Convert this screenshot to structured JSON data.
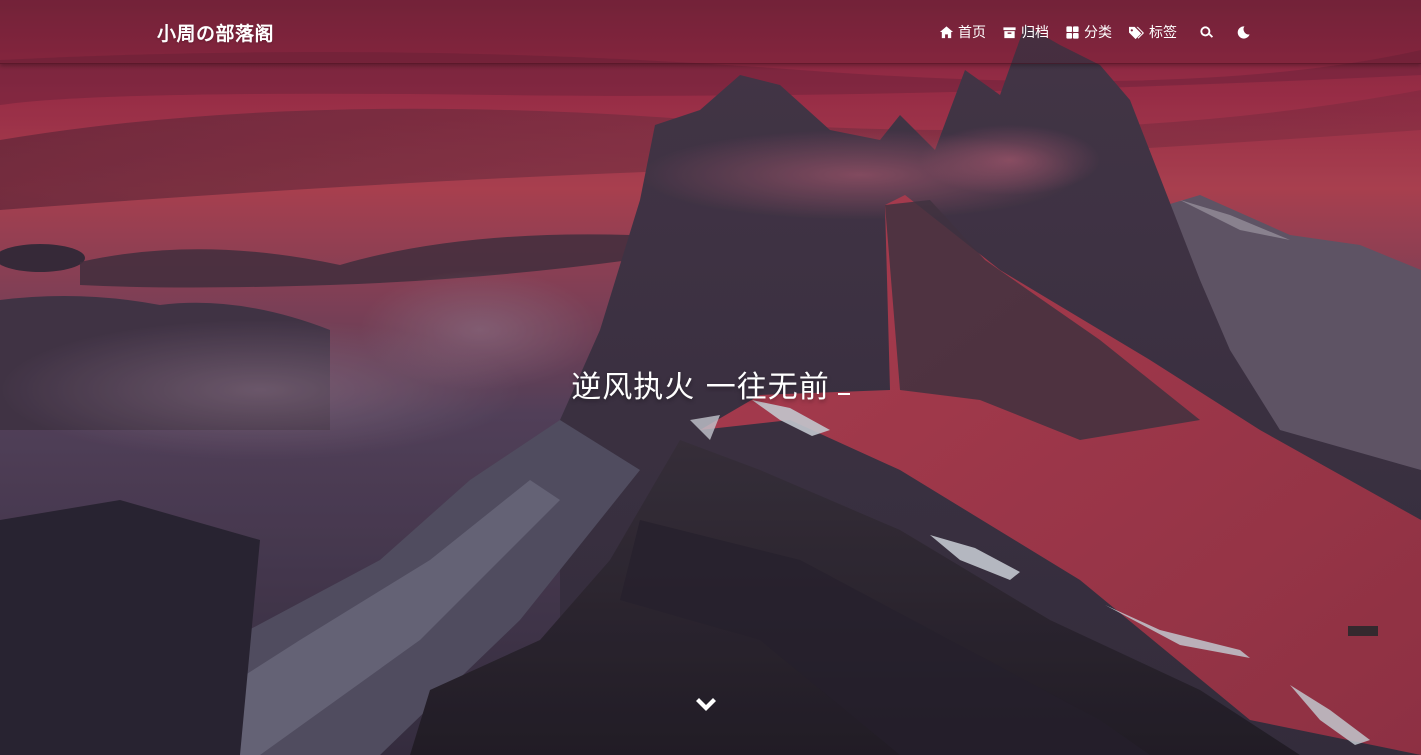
{
  "site": {
    "brand": "小周の部落阁",
    "slogan": "逆风执火 一往无前"
  },
  "nav": {
    "items": [
      {
        "label": "首页",
        "icon": "home-icon"
      },
      {
        "label": "归档",
        "icon": "archive-icon"
      },
      {
        "label": "分类",
        "icon": "th-large-icon"
      },
      {
        "label": "标签",
        "icon": "tags-icon"
      }
    ],
    "search_icon": "search-icon",
    "theme_icon": "moon-icon"
  },
  "scroll_icon": "chevron-down-icon",
  "colors": {
    "sky_top": "#b3324f",
    "sky_mid": "#c84a5a",
    "mountain_dark": "#3a3343",
    "ridge_red": "#b93d4d",
    "text": "#ffffff"
  }
}
